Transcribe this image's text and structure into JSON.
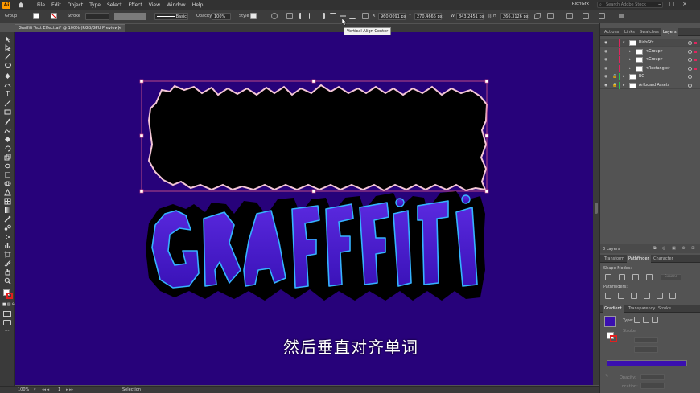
{
  "app": {
    "logo": "Ai",
    "workspace": "RichGfx",
    "search_placeholder": "Search Adobe Stock"
  },
  "menu": [
    "File",
    "Edit",
    "Object",
    "Type",
    "Select",
    "Effect",
    "View",
    "Window",
    "Help"
  ],
  "control_bar": {
    "selection_type": "Group",
    "stroke_label": "Stroke",
    "brush_style": "Basic",
    "opacity_label": "Opacity",
    "opacity_value": "100%",
    "style_label": "Style",
    "x_label": "X",
    "x_value": "960.0091 px",
    "y_label": "Y",
    "y_value": "270.4666 px",
    "w_label": "W",
    "w_value": "843.2451 px",
    "h_label": "H",
    "h_value": "266.3126 px"
  },
  "tooltip": "Vertical Align Center",
  "document_tab": {
    "title": "Graffiti Text Effect.ai* @ 100% (RGB/GPU Preview)",
    "close": "×"
  },
  "status_bar": {
    "zoom": "100%",
    "artboard": "1",
    "tool": "Selection"
  },
  "panels": {
    "layers_tabs": [
      "Actions",
      "Links",
      "Swatches",
      "Layers"
    ],
    "active_tab": "Layers",
    "layers": [
      {
        "name": "RichGfx",
        "indent": 0,
        "color": "#e0245e",
        "expanded": true,
        "locked": false
      },
      {
        "name": "<Group>",
        "indent": 1,
        "color": "#e0245e",
        "expanded": false,
        "locked": false
      },
      {
        "name": "<Group>",
        "indent": 1,
        "color": "#e0245e",
        "expanded": false,
        "locked": false
      },
      {
        "name": "<Rectangle>",
        "indent": 1,
        "color": "#e0245e",
        "expanded": false,
        "locked": false
      },
      {
        "name": "BG",
        "indent": 0,
        "color": "#27c24c",
        "expanded": false,
        "locked": true
      },
      {
        "name": "Artboard Assets",
        "indent": 0,
        "color": "#27c24c",
        "expanded": false,
        "locked": true
      }
    ],
    "layers_count": "3 Layers",
    "transform_tabs": [
      "Transform",
      "Pathfinder",
      "Character"
    ],
    "shape_modes_label": "Shape Modes:",
    "expand_label": "Expand",
    "pathfinders_label": "Pathfinders:",
    "gradient_tabs": [
      "Gradient",
      "Transparency",
      "Stroke"
    ],
    "gradient_type_label": "Type:",
    "gradient_stroke_label": "Stroke:",
    "gradient_opacity_label": "Opacity:",
    "gradient_location_label": "Location:",
    "gradient_color": "#3a0fb0"
  },
  "subtitle": "然后垂直对齐单词",
  "colors": {
    "artboard": "#27027a",
    "selection": "#e05a8a",
    "graffiti_fill": "#4a22c8",
    "graffiti_outline": "#35b3ff"
  }
}
